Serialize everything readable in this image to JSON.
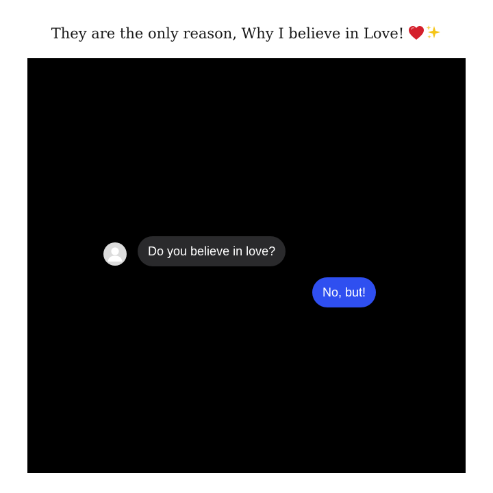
{
  "caption": {
    "text": "They are the only reason, Why I believe in Love!",
    "emoji_icons": [
      "red-heart-icon",
      "sparkles-icon"
    ],
    "heart_color": "#d4202c",
    "sparkle_color": "#f5c518"
  },
  "chat": {
    "background": "#000000",
    "messages": [
      {
        "direction": "incoming",
        "avatar_icon": "default-user-avatar",
        "text": "Do you believe in love?",
        "bubble_color": "#2a2a2c"
      },
      {
        "direction": "outgoing",
        "text": "No, but!",
        "bubble_color": "#2f4ff0"
      }
    ]
  }
}
